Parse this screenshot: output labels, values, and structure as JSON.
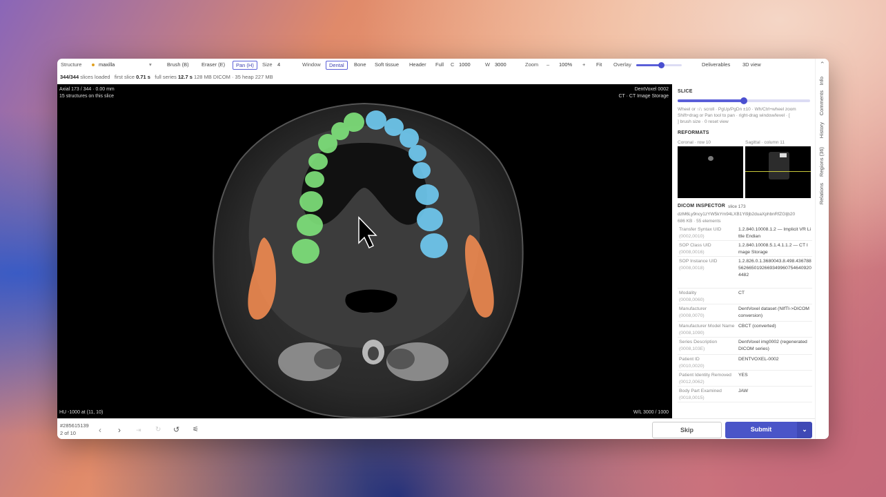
{
  "toolbar": {
    "structure_label": "Structure",
    "structure_value": "maxilla",
    "structure_color": "#e0a020",
    "brush": "Brush (B)",
    "eraser": "Eraser (E)",
    "pan": "Pan (H)",
    "size_label": "Size",
    "size_value": "4",
    "window_label": "Window",
    "presets": [
      "Dental",
      "Bone",
      "Soft tissue",
      "Header",
      "Full"
    ],
    "c_label": "C",
    "c_value": "1000",
    "w_label": "W",
    "w_value": "3000",
    "zoom_label": "Zoom",
    "zoom_minus": "–",
    "zoom_value": "100%",
    "zoom_plus": "+",
    "fit": "Fit",
    "overlay_label": "Overlay",
    "overlay_level": 0.55,
    "deliverables": "Deliverables",
    "view3d": "3D view"
  },
  "infobar": {
    "loaded": "344/344",
    "loaded_suffix": "slices loaded",
    "first_label": "first slice",
    "first_value": "0.71 s",
    "full_label": "full series",
    "full_value": "12.7 s",
    "mem": "128 MB DICOM · 35 heap 227 MB"
  },
  "viewer": {
    "top_left_1": "Axial 173 / 344 · 0.00 mm",
    "top_left_2": "15 structures on this slice",
    "top_right_1": "DentVoxel 0002",
    "top_right_2": "CT · CT Image Storage",
    "bottom_left": "HU -1000 at (11, 10)",
    "bottom_right": "W/L 3000 / 1000",
    "colors": {
      "teeth_left": "#7ee07a",
      "teeth_right": "#6fc9ef",
      "ramus": "#f08a50"
    }
  },
  "side": {
    "slice_title": "SLICE",
    "slice_level": 0.5,
    "help_1": "Wheel or ↑/↓ scroll · PgUp/PgDn ±10 · Wh/Ctrl+wheel zoom",
    "help_2": "Shift+drag or Pan tool to pan · right-drag window/level · [",
    "help_3": "] brush size · 0 reset view",
    "reformats_title": "REFORMATS",
    "coronal_label": "Coronal · row 10",
    "sagittal_label": "Sagittal · column 11",
    "inspector_title": "DICOM INSPECTOR",
    "inspector_slice": "slice 173",
    "inspector_file": "dzM6Ly9ncy1zYW5kYm94LXB1Yi9jb2duaXphbnRfZGljb20",
    "inspector_meta": "686 KB · 55 elements",
    "rows": [
      {
        "key": "Transfer Syntax UID",
        "tag": "(0002,0010)",
        "value": "1.2.840.10008.1.2 — Implicit VR Little Endian"
      },
      {
        "key": "SOP Class UID",
        "tag": "(0008,0016)",
        "value": "1.2.840.10008.5.1.4.1.1.2 — CT Image Storage"
      },
      {
        "key": "SOP Instance UID",
        "tag": "(0008,0018)",
        "value": "1.2.826.0.1.3680043.8.498.4367885626650192669349960754640920 4482"
      },
      {
        "key": "Modality",
        "tag": "(0008,0060)",
        "value": "CT"
      },
      {
        "key": "Manufacturer",
        "tag": "(0008,0070)",
        "value": "DentVoxel dataset (NIfTI->DICOM conversion)"
      },
      {
        "key": "Manufacturer Model Name",
        "tag": "(0008,1090)",
        "value": "CBCT (converted)"
      },
      {
        "key": "Series Description",
        "tag": "(0008,103E)",
        "value": "DentVoxel img0002 (regenerated DICOM series)"
      },
      {
        "key": "Patient ID",
        "tag": "(0010,0020)",
        "value": "DENTVOXEL-0002"
      },
      {
        "key": "Patient Identity Removed",
        "tag": "(0012,0062)",
        "value": "YES"
      },
      {
        "key": "Body Part Examined",
        "tag": "(0018,0015)",
        "value": "JAW"
      }
    ]
  },
  "tabs": [
    "Info",
    "Comments",
    "History",
    "Regions (36)",
    "Relations"
  ],
  "bottom": {
    "task_id": "#285615139",
    "task_pos": "2 of 10",
    "skip": "Skip",
    "submit": "Submit"
  }
}
